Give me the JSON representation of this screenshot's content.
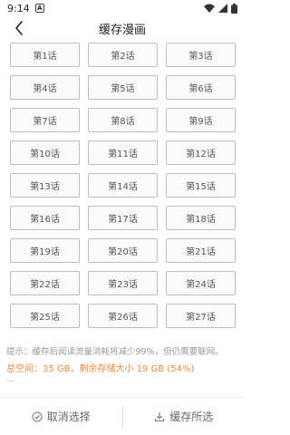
{
  "status_bar": {
    "time": "9:14",
    "notice_letter": "A"
  },
  "header": {
    "title": "缓存漫画"
  },
  "chapters": [
    "第1话",
    "第2话",
    "第3话",
    "第4话",
    "第5话",
    "第6话",
    "第7话",
    "第8话",
    "第9话",
    "第10话",
    "第11话",
    "第12话",
    "第13话",
    "第14话",
    "第15话",
    "第16话",
    "第17话",
    "第18话",
    "第19话",
    "第20话",
    "第21话",
    "第22话",
    "第23话",
    "第24话",
    "第25话",
    "第26话",
    "第27话"
  ],
  "footer": {
    "tip": "提示：缓存后阅读流量消耗将减少99%，但仍需要联网。",
    "storage": "总空间：35 GB，剩余存储大小 19 GB (54%)",
    "ellipsis": "..."
  },
  "bottom_bar": {
    "cancel_label": "取消选择",
    "cache_label": "缓存所选"
  },
  "colors": {
    "accent": "#f0883c",
    "border": "#bdbdbd",
    "text": "#555555"
  }
}
